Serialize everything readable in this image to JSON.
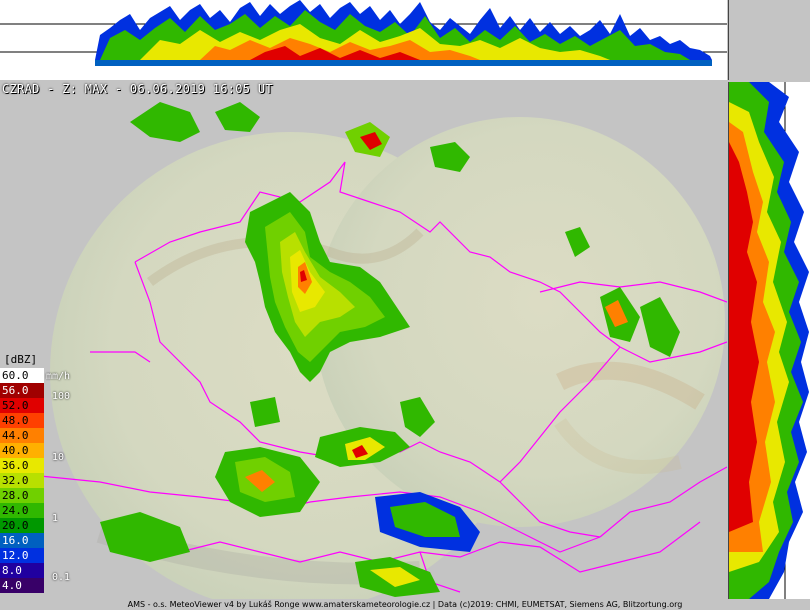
{
  "title": "CZRAD - Z: MAX - 06.06.2019 16:05 UT",
  "legend": {
    "unit_label": "[dBZ]",
    "rate_unit": "mm/h",
    "levels": [
      {
        "label": "60.0",
        "color": "#ffffff"
      },
      {
        "label": "56.0",
        "color": "#a00000"
      },
      {
        "label": "52.0",
        "color": "#e00000"
      },
      {
        "label": "48.0",
        "color": "#ff4000"
      },
      {
        "label": "44.0",
        "color": "#ff8000"
      },
      {
        "label": "40.0",
        "color": "#ffb000"
      },
      {
        "label": "36.0",
        "color": "#e8e800"
      },
      {
        "label": "32.0",
        "color": "#b8e000"
      },
      {
        "label": "28.0",
        "color": "#70d000"
      },
      {
        "label": "24.0",
        "color": "#30b800"
      },
      {
        "label": "20.0",
        "color": "#009800"
      },
      {
        "label": "16.0",
        "color": "#0060c0"
      },
      {
        "label": "12.0",
        "color": "#0030e0"
      },
      {
        "label": "8.0",
        "color": "#2000a0"
      },
      {
        "label": "4.0",
        "color": "#380068"
      }
    ],
    "rates": [
      "100",
      "10",
      "1",
      "0.1"
    ]
  },
  "footer": "AMS - o.s. MeteoViewer v4 by Lukáš Ronge www.amaterskameteorologie.cz | Data (c)2019: CHMI, EUMETSAT, Siemens AG, Blitzortung.org",
  "colors": {
    "background": "#c4c4c4",
    "border": "#ff00ff",
    "coverage": "#d8dcc8"
  }
}
